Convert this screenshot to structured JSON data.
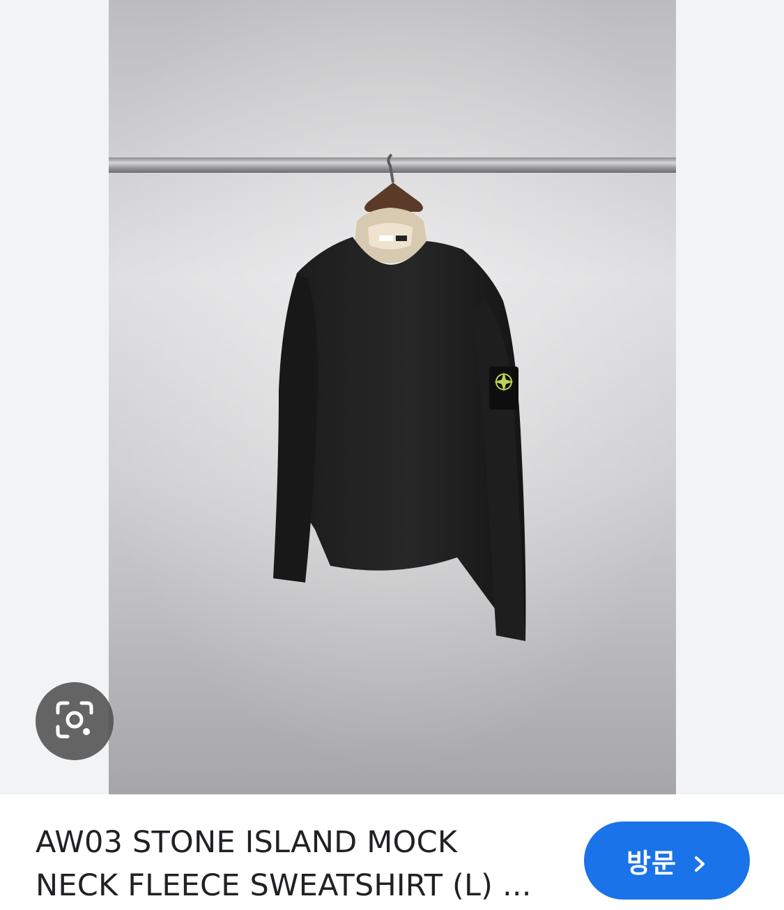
{
  "result": {
    "title_line1": "AW03 STONE ISLAND MOCK",
    "title_line2": "NECK FLEECE SWEATSHIRT (L) ...",
    "visit_label": "방문"
  },
  "icons": {
    "lens": "google-lens-icon",
    "visit_chevron": "chevron-right-icon"
  },
  "colors": {
    "visit_button": "#1a73e8",
    "lens_button": "#505050",
    "title_text": "#202124",
    "side_background": "#f1f3f4"
  }
}
